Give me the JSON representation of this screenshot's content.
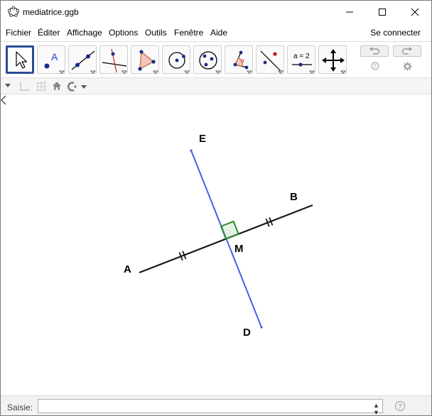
{
  "window": {
    "title": "mediatrice.ggb",
    "app_icon": "geogebra-pentagon-icon"
  },
  "menubar": {
    "items": [
      "Fichier",
      "Éditer",
      "Affichage",
      "Options",
      "Outils",
      "Fenêtre",
      "Aide"
    ],
    "connect_label": "Se connecter"
  },
  "toolbar": {
    "tools": [
      {
        "name": "move-tool",
        "icon": "arrow-cursor-icon"
      },
      {
        "name": "point-tool",
        "icon": "point-icon",
        "text": "A"
      },
      {
        "name": "line-tool",
        "icon": "line-through-two-points-icon"
      },
      {
        "name": "perpendicular-tool",
        "icon": "perpendicular-line-icon"
      },
      {
        "name": "polygon-tool",
        "icon": "polygon-icon"
      },
      {
        "name": "circle-tool",
        "icon": "circle-with-center-icon"
      },
      {
        "name": "circle-three-points-tool",
        "icon": "circle-through-three-points-icon"
      },
      {
        "name": "angle-tool",
        "icon": "angle-icon",
        "text": "α"
      },
      {
        "name": "reflect-tool",
        "icon": "reflect-about-line-icon"
      },
      {
        "name": "slider-tool",
        "icon": "slider-icon",
        "text": "a = 2"
      },
      {
        "name": "move-graphics-tool",
        "icon": "move-graphics-view-icon"
      }
    ],
    "undo_icon": "undo-icon",
    "redo_icon": "redo-icon",
    "help_icon": "help-icon",
    "settings_icon": "gear-icon"
  },
  "graphics": {
    "points": {
      "A": "A",
      "B": "B",
      "D": "D",
      "E": "E",
      "M": "M"
    },
    "colors": {
      "segment": "#1a1a1a",
      "bisector": "#4a5de6",
      "right_angle": "#2e8b2e"
    }
  },
  "inputbar": {
    "label": "Saisie:",
    "value": "",
    "help_icon": "help-icon"
  }
}
